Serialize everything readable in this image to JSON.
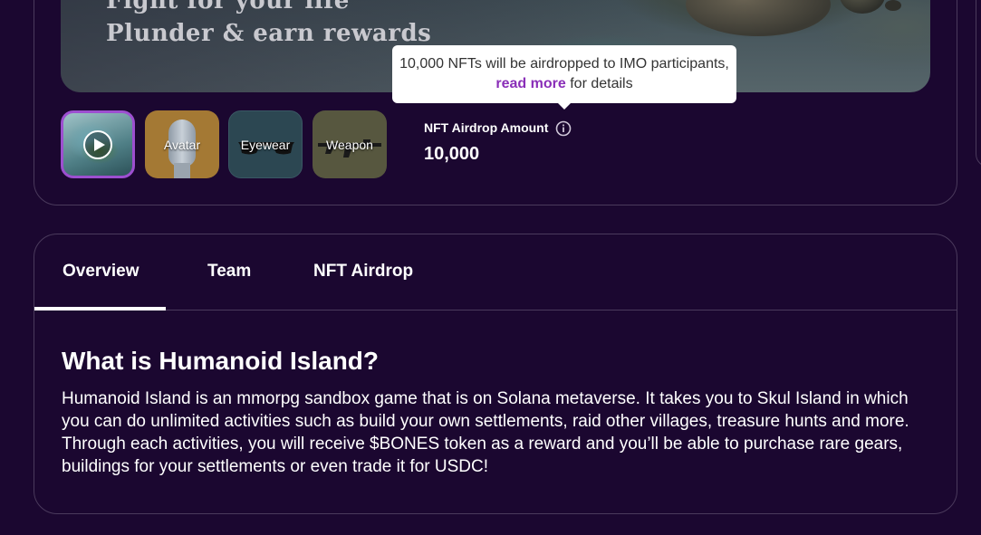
{
  "hero": {
    "line1": "Fight for your life",
    "line2": "Plunder & earn rewards"
  },
  "tooltip": {
    "text_before": "10,000 NFTs will be airdropped to IMO participants, ",
    "link": "read more",
    "text_after": " for details"
  },
  "thumbnails": [
    {
      "label": "",
      "icon": "play-icon"
    },
    {
      "label": "Avatar"
    },
    {
      "label": "Eyewear"
    },
    {
      "label": "Weapon"
    }
  ],
  "airdrop": {
    "label": "NFT Airdrop Amount",
    "icon": "info-icon",
    "value": "10,000"
  },
  "tabs": [
    {
      "label": "Overview",
      "active": true
    },
    {
      "label": "Team",
      "active": false
    },
    {
      "label": "NFT Airdrop",
      "active": false
    }
  ],
  "overview": {
    "title": "What is Humanoid Island?",
    "body": "Humanoid Island is an mmorpg sandbox game that is on Solana metaverse. It takes you to Skul Island in which you can do unlimited activities such as build your own settlements, raid other villages, treasure hunts and more. Through each activities, you will receive $BONES token as a reward and you’ll be able to purchase rare gears, buildings for your settlements or even trade it for USDC!"
  },
  "colors": {
    "background": "#1b0730",
    "border": "#4a3a5c",
    "accent": "#9d4fd0",
    "link": "#8a2fb8"
  }
}
